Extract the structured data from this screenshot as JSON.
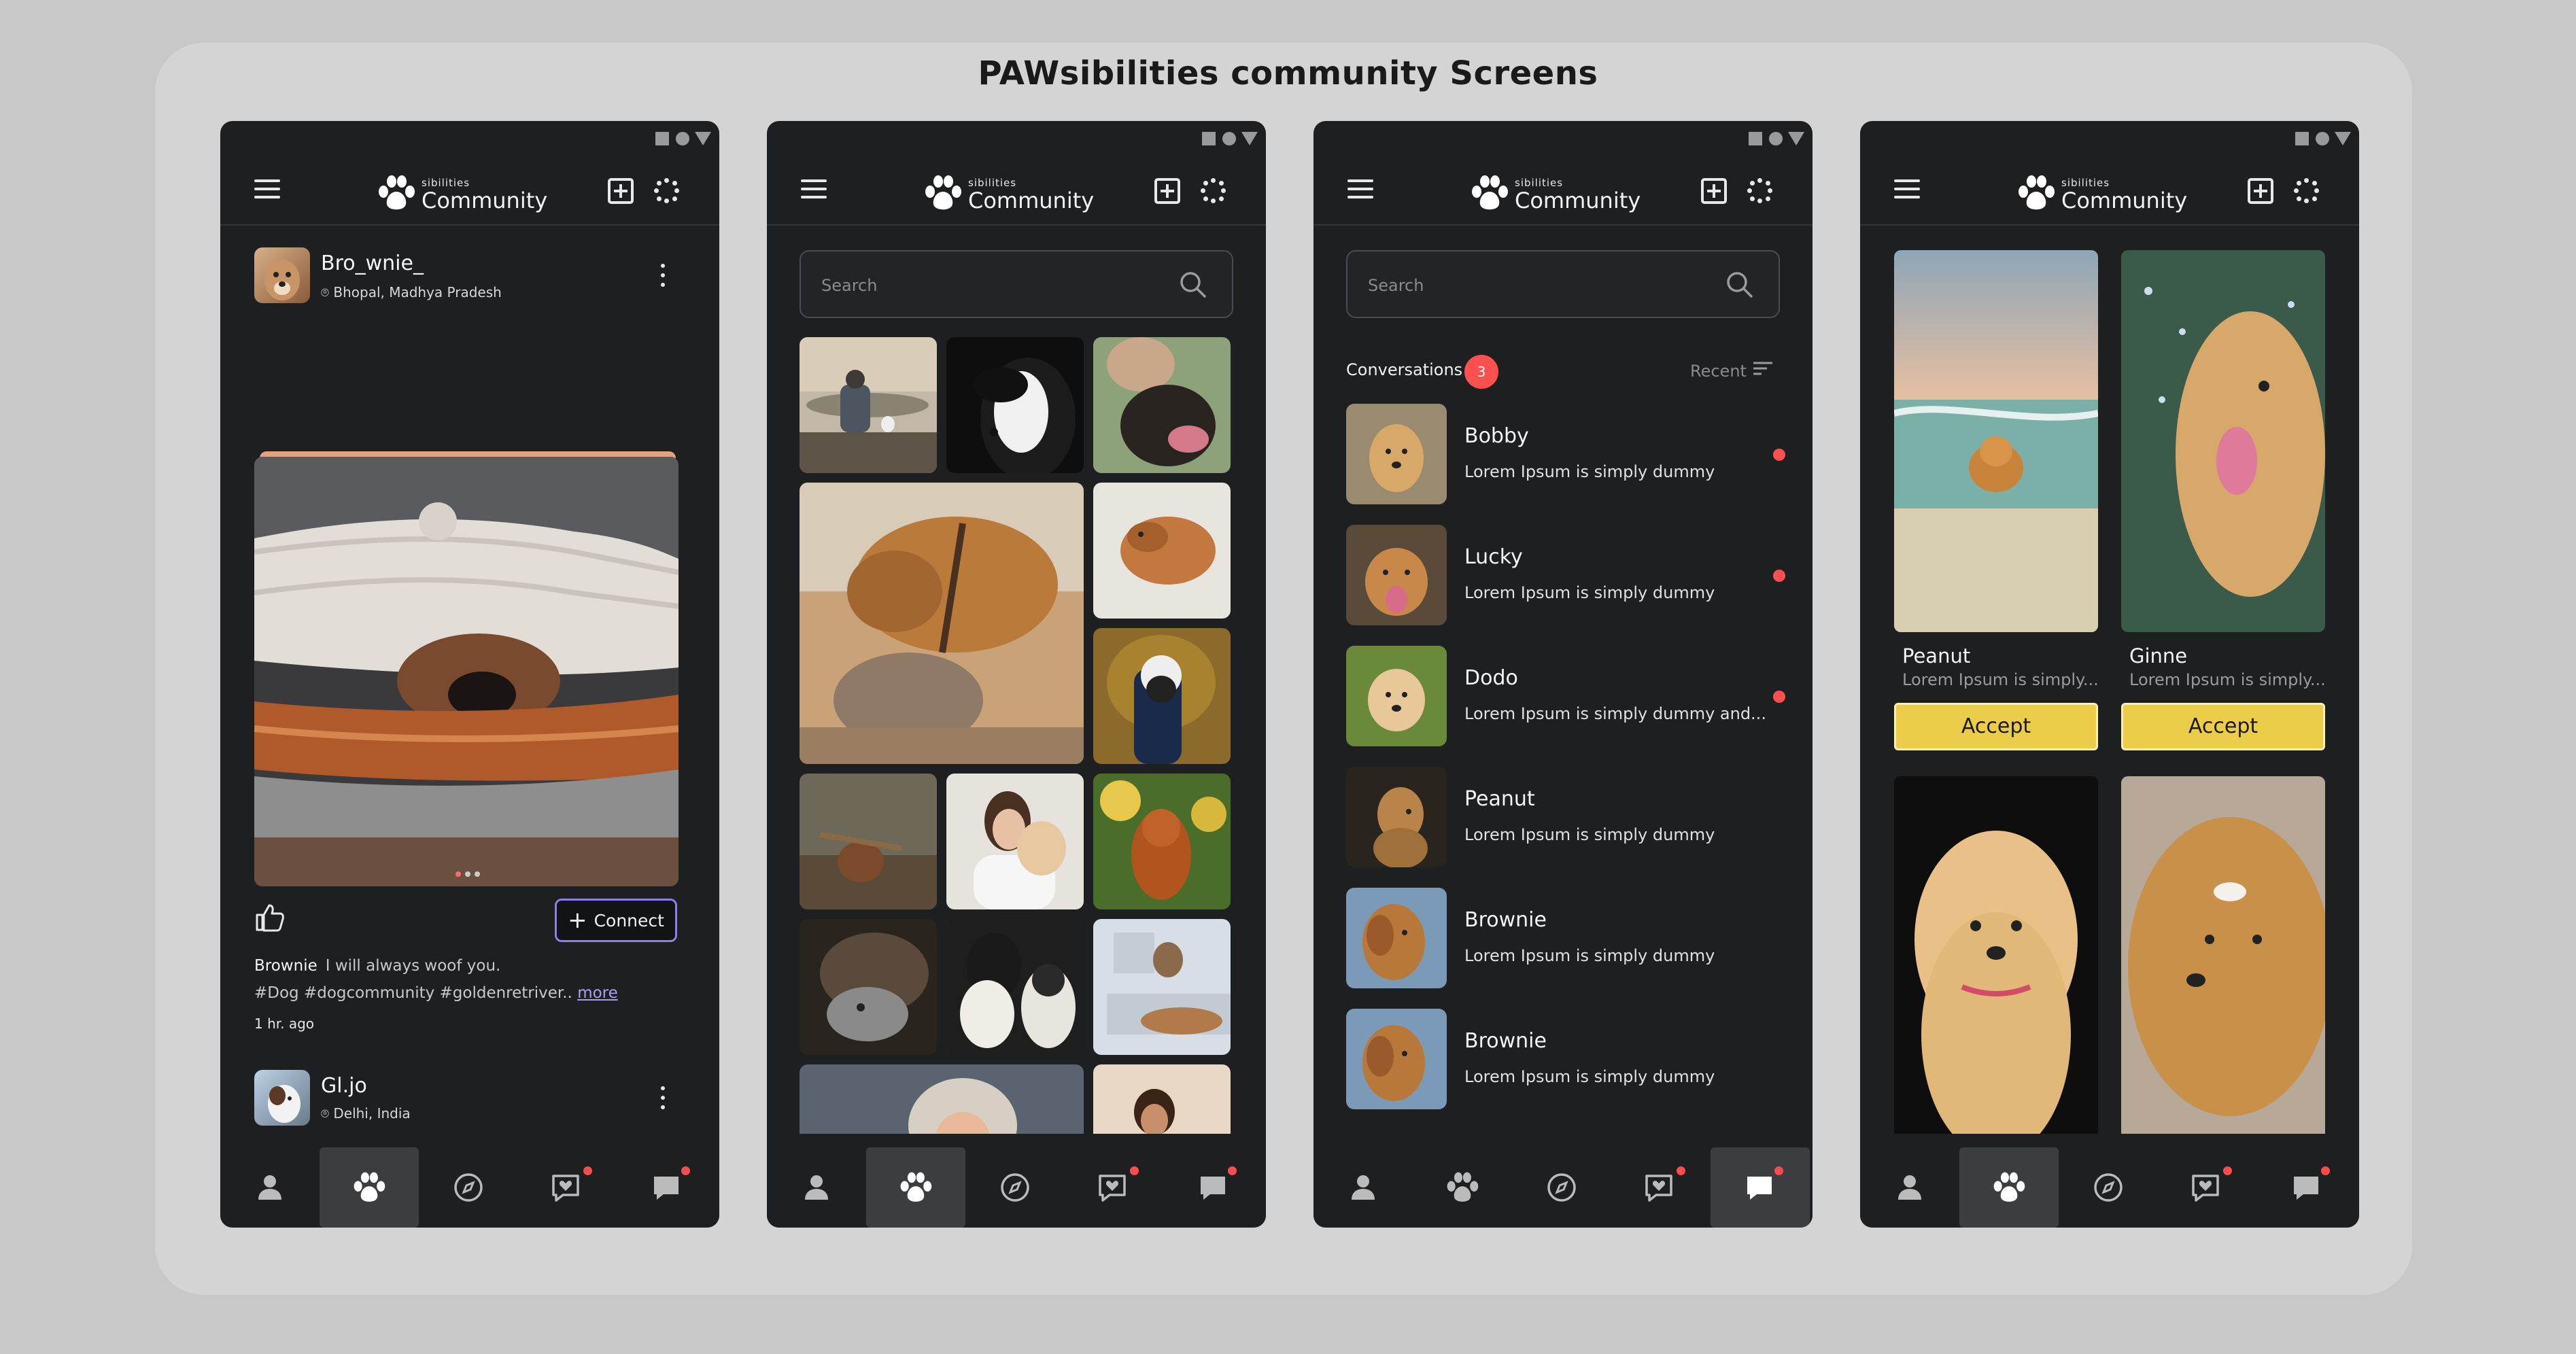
{
  "board_title": "PAWsibilities community Screens",
  "header": {
    "logo_super": "sibilities",
    "logo_main": "Community"
  },
  "search": {
    "placeholder": "Search"
  },
  "feed": {
    "post1": {
      "username": "Bro_wnie_",
      "location": "Bhopal, Madhya Pradesh",
      "caption_user": "Brownie",
      "caption_text": "I will always woof you.",
      "hashtags": "#Dog #dogcommunity #goldenretriver..",
      "more": "more",
      "time": "1 hr. ago",
      "connect_label": "Connect"
    },
    "post2": {
      "username": "Gl.jo",
      "location": "Delhi, India"
    }
  },
  "messages": {
    "title": "Conversations",
    "badge_count": "3",
    "sort_label": "Recent",
    "items": [
      {
        "name": "Bobby",
        "message": "Lorem Ipsum is simply dummy",
        "unread": true
      },
      {
        "name": "Lucky",
        "message": "Lorem Ipsum is simply dummy",
        "unread": true
      },
      {
        "name": "Dodo",
        "message": "Lorem Ipsum is simply dummy and...",
        "unread": true
      },
      {
        "name": "Peanut",
        "message": "Lorem Ipsum is simply dummy",
        "unread": false
      },
      {
        "name": "Brownie",
        "message": "Lorem Ipsum is simply dummy",
        "unread": false
      },
      {
        "name": "Brownie",
        "message": "Lorem Ipsum is simply dummy",
        "unread": false
      }
    ]
  },
  "requests": {
    "cards": [
      {
        "name": "Peanut",
        "desc": "Lorem Ipsum is simply...",
        "button": "Accept"
      },
      {
        "name": "Ginne",
        "desc": "Lorem Ipsum is simply...",
        "button": "Accept"
      }
    ]
  },
  "nav": [
    "profile-icon",
    "paw-icon",
    "compass-icon",
    "heart-chat-icon",
    "chat-icon"
  ],
  "colors": {
    "accent_purple": "#8f7cf0",
    "accept_yellow": "#eccd4a",
    "badge_red": "#ff4f4f",
    "phone_bg": "#1e1f21"
  }
}
